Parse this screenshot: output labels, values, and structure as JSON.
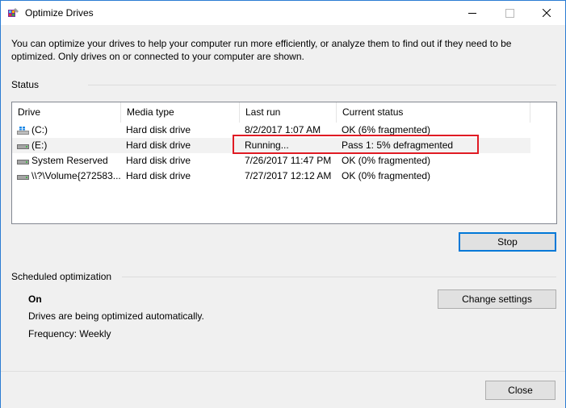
{
  "window": {
    "title": "Optimize Drives",
    "accent": "#2b7cd3"
  },
  "description": "You can optimize your drives to help your computer run more efficiently, or analyze them to find out if they need to be optimized. Only drives on or connected to your computer are shown.",
  "status": {
    "label": "Status",
    "columns": [
      "Drive",
      "Media type",
      "Last run",
      "Current status"
    ],
    "rows": [
      {
        "drive": "(C:)",
        "icon": "windows-drive-icon",
        "media": "Hard disk drive",
        "last_run": "8/2/2017 1:07 AM",
        "status": "OK (6% fragmented)"
      },
      {
        "drive": "(E:)",
        "icon": "hard-drive-icon",
        "media": "Hard disk drive",
        "last_run": "Running...",
        "status": "Pass 1: 5% defragmented"
      },
      {
        "drive": "System Reserved",
        "icon": "hard-drive-icon",
        "media": "Hard disk drive",
        "last_run": "7/26/2017 11:47 PM",
        "status": "OK (0% fragmented)"
      },
      {
        "drive": "\\\\?\\Volume{272583...",
        "icon": "hard-drive-icon",
        "media": "Hard disk drive",
        "last_run": "7/27/2017 12:12 AM",
        "status": "OK (0% fragmented)"
      }
    ],
    "highlight_color": "#e01b24"
  },
  "buttons": {
    "stop": "Stop",
    "change_settings": "Change settings",
    "close": "Close"
  },
  "scheduled": {
    "label": "Scheduled optimization",
    "state": "On",
    "info": "Drives are being optimized automatically.",
    "frequency": "Frequency: Weekly"
  }
}
